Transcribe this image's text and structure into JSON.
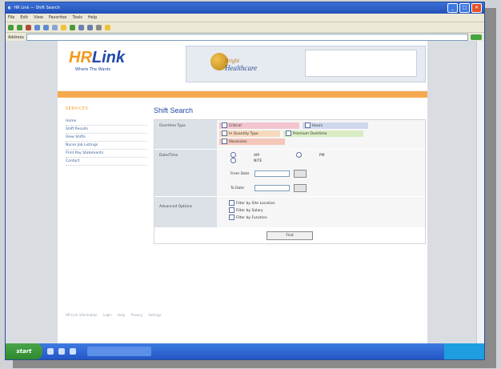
{
  "window": {
    "title": "HR Link — Shift Search",
    "menu": [
      "File",
      "Edit",
      "View",
      "Favorites",
      "Tools",
      "Help"
    ],
    "address": ""
  },
  "page": {
    "logo": {
      "hr": "HR",
      "link": "Link",
      "tagline": "Where The Wards"
    },
    "partner": {
      "name": "Bright",
      "name2": "Healthcare",
      "note": ""
    },
    "orange_bar_text": ""
  },
  "nav": {
    "heading": "SERVICES",
    "items": [
      "Home",
      "Shift Results",
      "View Shifts",
      "Nurse Job Listings",
      "Print Pay Statements",
      "Contact"
    ]
  },
  "search": {
    "title": "Shift Search",
    "labels": {
      "type": "Overtime Type",
      "date": "Date/Time",
      "adv": "Advanced Options"
    },
    "types": [
      "Critical",
      "Hours",
      "In Quantity Type",
      "Premium Overtime",
      "Vacancies"
    ],
    "radios": [
      "AM",
      "PM",
      "NITE"
    ],
    "from_label": "From Date",
    "from_value": "",
    "to_label": "To Date",
    "to_value": "",
    "adv_options": [
      "Filter by Site Location",
      "Filter by Salary",
      "Filter by Function"
    ],
    "find_button": "Find"
  },
  "footer": {
    "links": [
      "HR Link Information",
      "Login",
      "Help",
      "Privacy",
      "Settings"
    ],
    "right": ""
  },
  "taskbar": {
    "start": "start",
    "task": ""
  },
  "colors": {
    "accent": "#f39a1e",
    "brand": "#1f4aa8",
    "title_bar": "#2352b7"
  }
}
